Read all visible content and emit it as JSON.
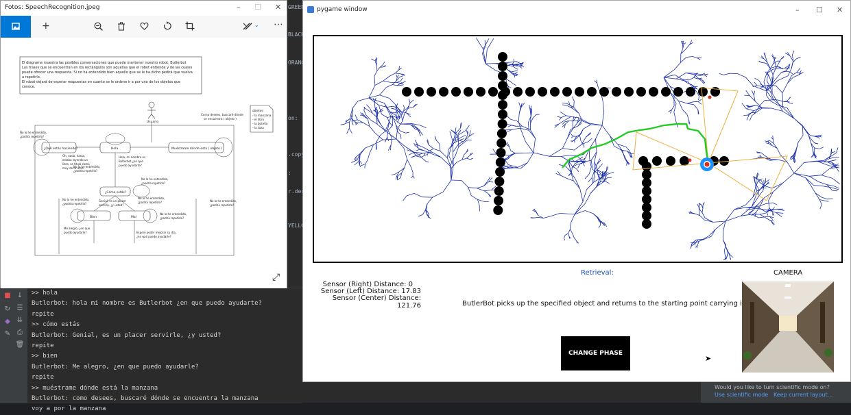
{
  "ide": {
    "code_fragments": [
      "GREEN",
      "BLACK",
      "ORANG",
      "on:",
      ".copy",
      ":",
      "r.des",
      "YELLO"
    ]
  },
  "console": {
    "lines": [
      ">> hola",
      "Butlerbot: hola mi nombre es Butlerbot ¿en que puedo ayudarte?",
      "repite",
      ">> cómo estás",
      "Butlerbot: Genial, es un placer servirle, ¿y usted?",
      "repite",
      ">> bien",
      "Butlerbot: Me alegro, ¿en que puedo ayudarle?",
      "repite",
      ">> muéstrame dónde está la manzana",
      "Butlerbot: como desees, buscaré dónde se encuentra la manzana",
      "voy a por la manzana"
    ]
  },
  "photos": {
    "title": "Fotos: SpeechRecognition.jpeg",
    "diagram": {
      "intro": [
        "El diagrama muestra las posibles conversaciones que puede mantener nuestro robot, Butlerbot",
        "Las frases que se encuentran en los rectángulos son aquellas que el robot entiende y de las cuales",
        "puede ofrecer una respuesta. Si no ha entendido bien aquello que se le ha dicho pedirá que vuelva",
        "a repetirlo.",
        "El robot dejará de esperar respuestas en cuanto se le ordene ir a por uno de los objetos que",
        "conoce."
      ],
      "actor": "Usuario",
      "states": [
        "¿Qué estás haciendo?",
        "Hola",
        "Muéstrame dónde está ( objeto )",
        "¿Cómo estás?",
        "Bien",
        "Mal"
      ],
      "notes": {
        "objects_title": "objetos:",
        "objects": [
          "- la manzana",
          "- el libro",
          "- la botella",
          "- la taza"
        ],
        "como_desees": [
          "Como desees, buscaré dónde",
          "se encuentra ( objeto )"
        ],
        "no_entendido_1": [
          "No lo he entendido,",
          "¿podría repetirlo?"
        ],
        "no_entendido_2": [
          "No lo he entendido,",
          "¿podría repetirlo?"
        ],
        "no_entendido_3": [
          "No lo he entendido,",
          "¿podría repetirlo?"
        ],
        "no_entendido_4": [
          "No lo he entendido,",
          "¿podría repetirlo?"
        ],
        "no_entendido_5": [
          "No lo he entendido,",
          "¿podría repetirlo?"
        ],
        "no_entendido_6": [
          "No lo he entendido,",
          "¿podría repetirlo?"
        ],
        "no_entendido_7": [
          "No lo he entendido,",
          "¿podría repetirlo?"
        ],
        "haciendo": [
          "Oh, nada, hasta,",
          "estaba leyendo un",
          "libro, se titula como",
          "muy de tu amo."
        ],
        "hola_reply": [
          "Hola, mi nombre es",
          "Butlerbot ¿en que",
          "puedo ayudarte?"
        ],
        "genial": [
          "Genial, es un placer",
          "servirle, ¿y usted?"
        ],
        "alegro": [
          "Me alegro, ¿en que",
          "puedo ayudarle?"
        ],
        "espero": [
          "Espero poder mejorar su día,",
          "¿en qué puedo ayudarle?"
        ]
      }
    }
  },
  "pygame": {
    "title": "pygame window",
    "sensors": {
      "right": "Sensor (Right) Distance: 0",
      "left": "Sensor (Left) Distance: 17.83",
      "center": "Sensor (Center) Distance: 121.76"
    },
    "phase_title": "Retrieval:",
    "phase_description": "ButlerBot picks up the specified object and returns to the starting point carrying it.",
    "change_phase_label": "CHANGE PHASE",
    "camera_label": "CAMERA"
  },
  "notification": {
    "text": "Would you like to turn scientific mode on?",
    "link_yes": "Use scientific mode",
    "link_no": "Keep current layout..."
  },
  "colors": {
    "accent_blue": "#0078d7",
    "tree_blue": "#1a2fa8",
    "path_green": "#22cc22",
    "fov_orange": "#f0b040",
    "robot_blue": "#1e90ff"
  }
}
